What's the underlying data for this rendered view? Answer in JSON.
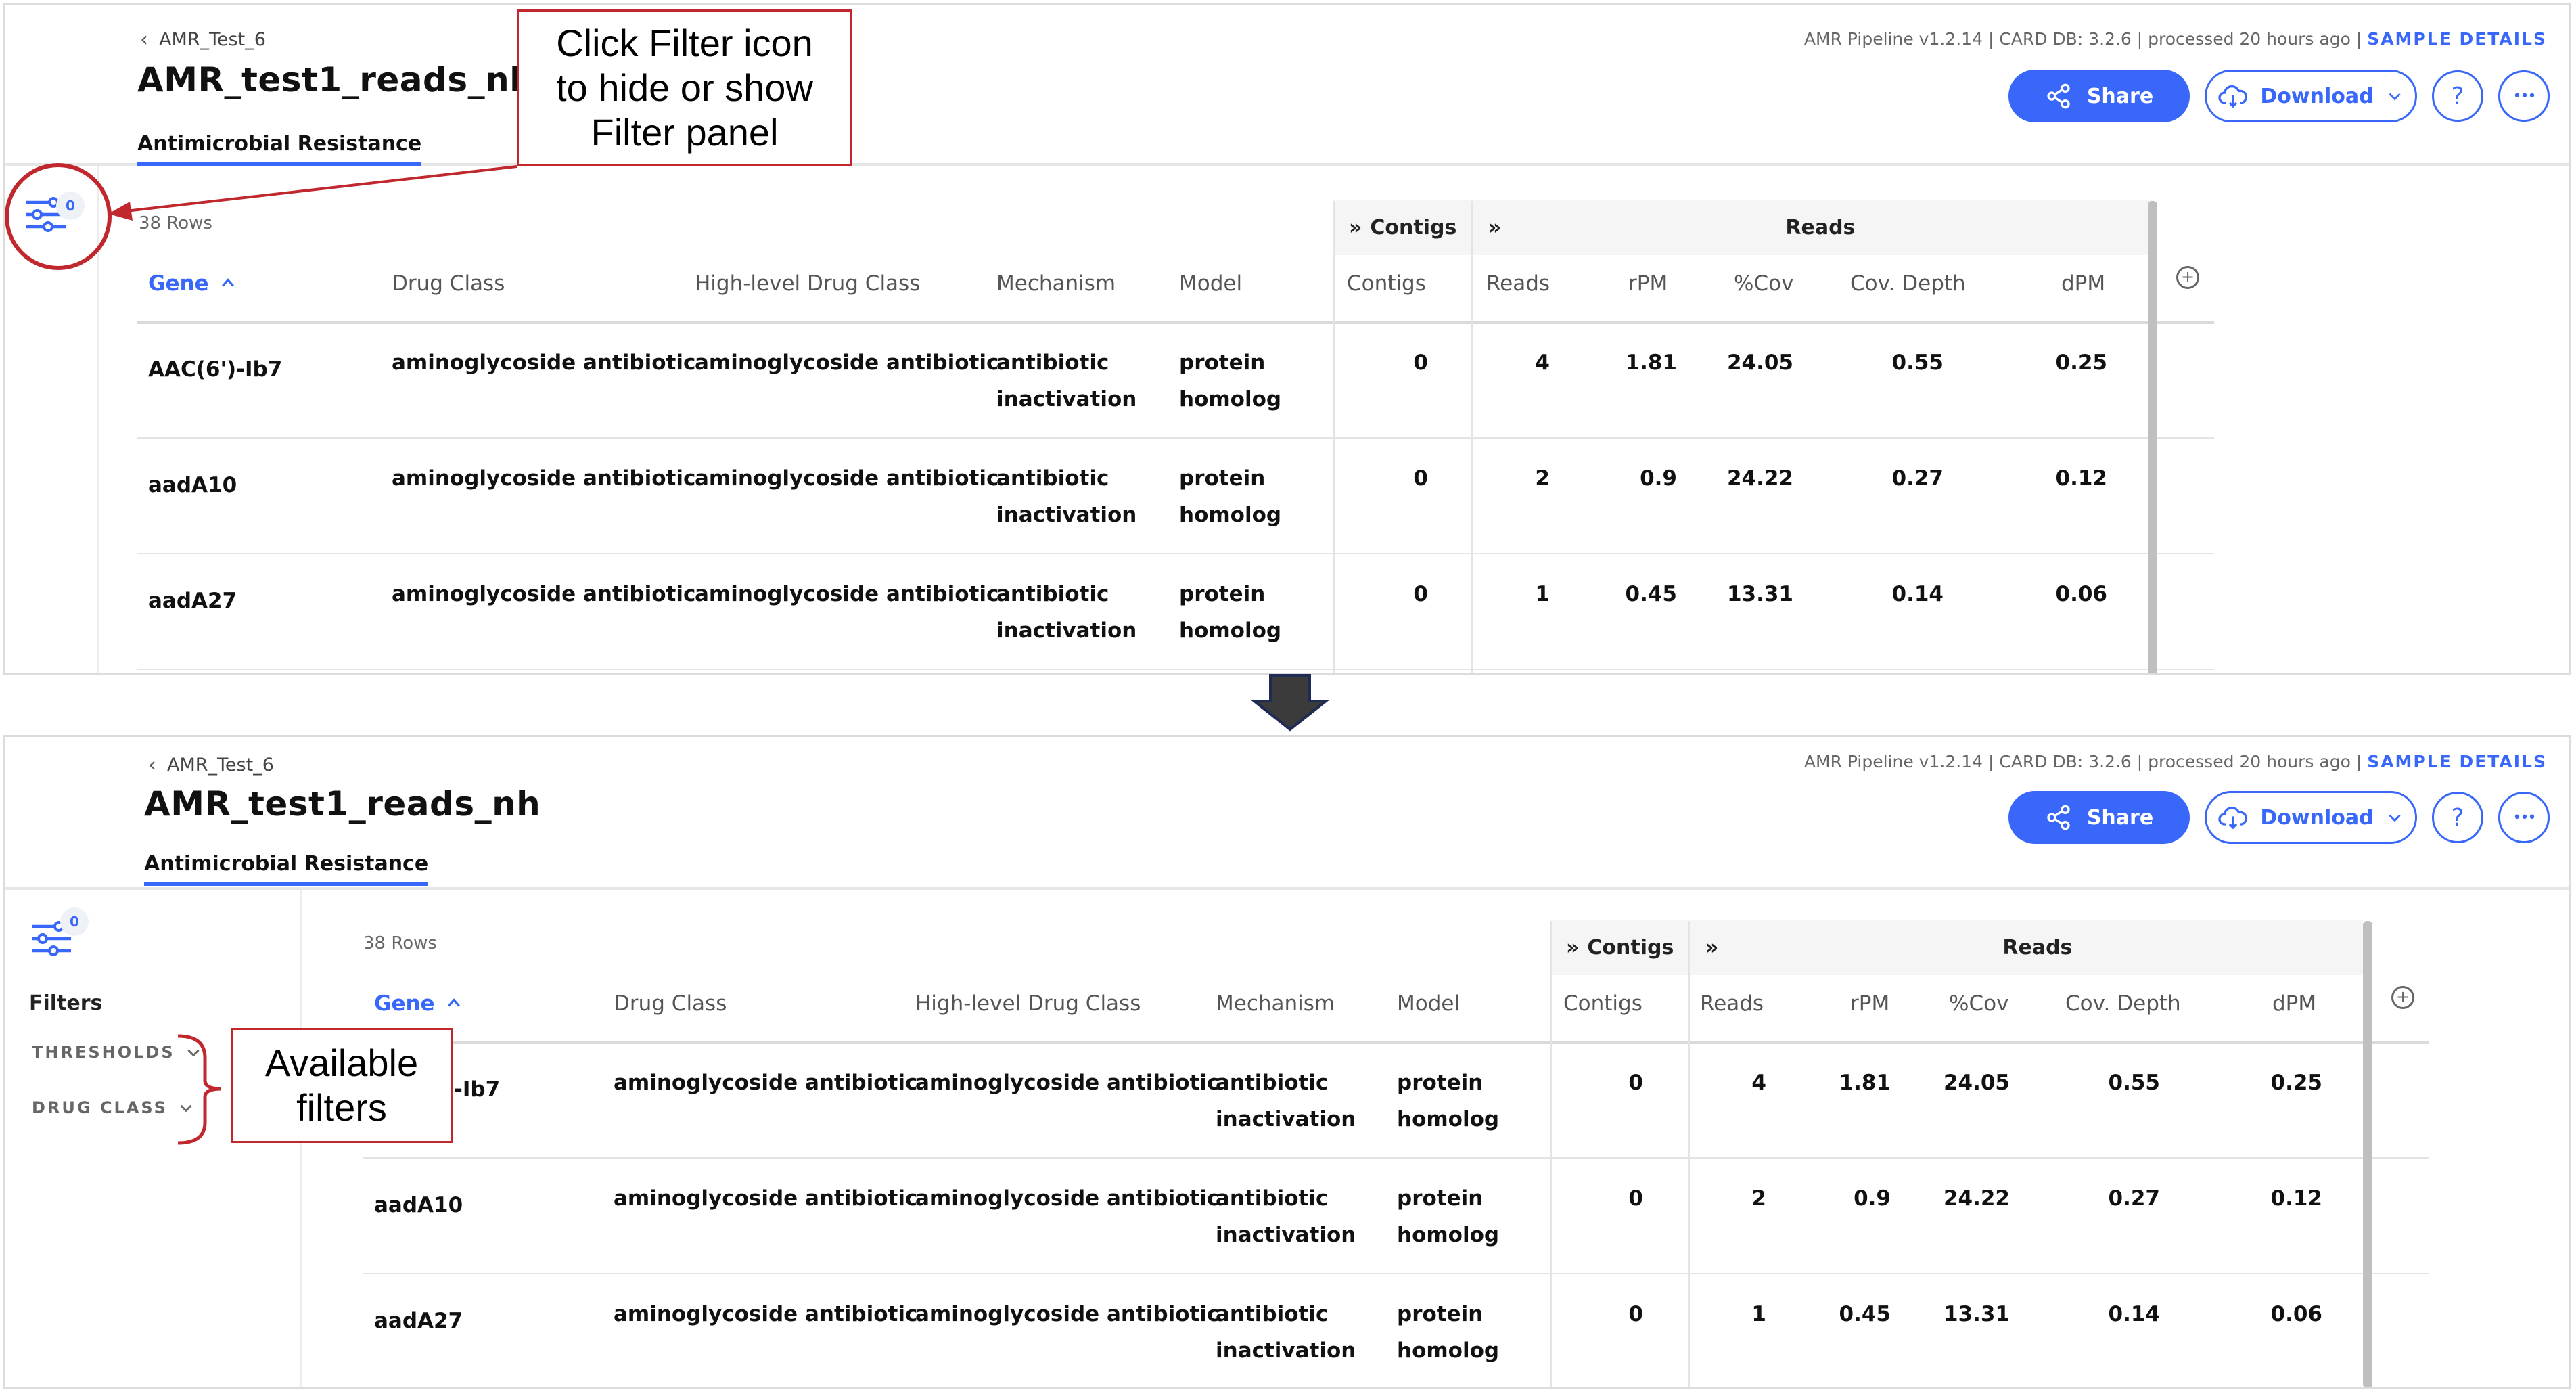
{
  "app": {
    "breadcrumb": "AMR_Test_6",
    "sample_title": "AMR_test1_reads_nh",
    "tab_label": "Antimicrobial Resistance",
    "meta_text": "AMR Pipeline v1.2.14 | CARD DB: 3.2.6 | processed 20 hours ago | ",
    "sample_details_link": "SAMPLE DETAILS",
    "share_label": "Share",
    "download_label": "Download",
    "help_label": "?",
    "more_label": "•••",
    "filter_badge_count": "0",
    "accent_color": "#3867fa"
  },
  "filter_panel": {
    "heading": "Filters",
    "items": [
      "THRESHOLDS",
      "DRUG CLASS"
    ]
  },
  "table": {
    "rows_label": "38 Rows",
    "group_contigs": "Contigs",
    "group_reads": "Reads",
    "expand_glyph": "»",
    "columns": [
      "Gene",
      "Drug Class",
      "High-level Drug Class",
      "Mechanism",
      "Model",
      "Contigs",
      "Reads",
      "rPM",
      "%Cov",
      "Cov. Depth",
      "dPM"
    ],
    "rows": [
      {
        "gene": "AAC(6')-Ib7",
        "drug_class": "aminoglycoside antibiotic",
        "high_level": "aminoglycoside antibiotic",
        "mech1": "antibiotic",
        "mech2": "inactivation",
        "model1": "protein",
        "model2": "homolog",
        "contigs": "0",
        "reads": "4",
        "rpm": "1.81",
        "cov": "24.05",
        "depth": "0.55",
        "dpm": "0.25"
      },
      {
        "gene": "aadA10",
        "drug_class": "aminoglycoside antibiotic",
        "high_level": "aminoglycoside antibiotic",
        "mech1": "antibiotic",
        "mech2": "inactivation",
        "model1": "protein",
        "model2": "homolog",
        "contigs": "0",
        "reads": "2",
        "rpm": "0.9",
        "cov": "24.22",
        "depth": "0.27",
        "dpm": "0.12"
      },
      {
        "gene": "aadA27",
        "drug_class": "aminoglycoside antibiotic",
        "high_level": "aminoglycoside antibiotic",
        "mech1": "antibiotic",
        "mech2": "inactivation",
        "model1": "protein",
        "model2": "homolog",
        "contigs": "0",
        "reads": "1",
        "rpm": "0.45",
        "cov": "13.31",
        "depth": "0.14",
        "dpm": "0.06"
      }
    ],
    "row2_gene_partial": "-Ib7"
  },
  "annotations": {
    "callout_top": [
      "Click Filter icon",
      "to hide or show",
      "Filter panel"
    ],
    "callout_bottom": [
      "Available",
      "filters"
    ],
    "annotation_color": "#c0282e"
  }
}
